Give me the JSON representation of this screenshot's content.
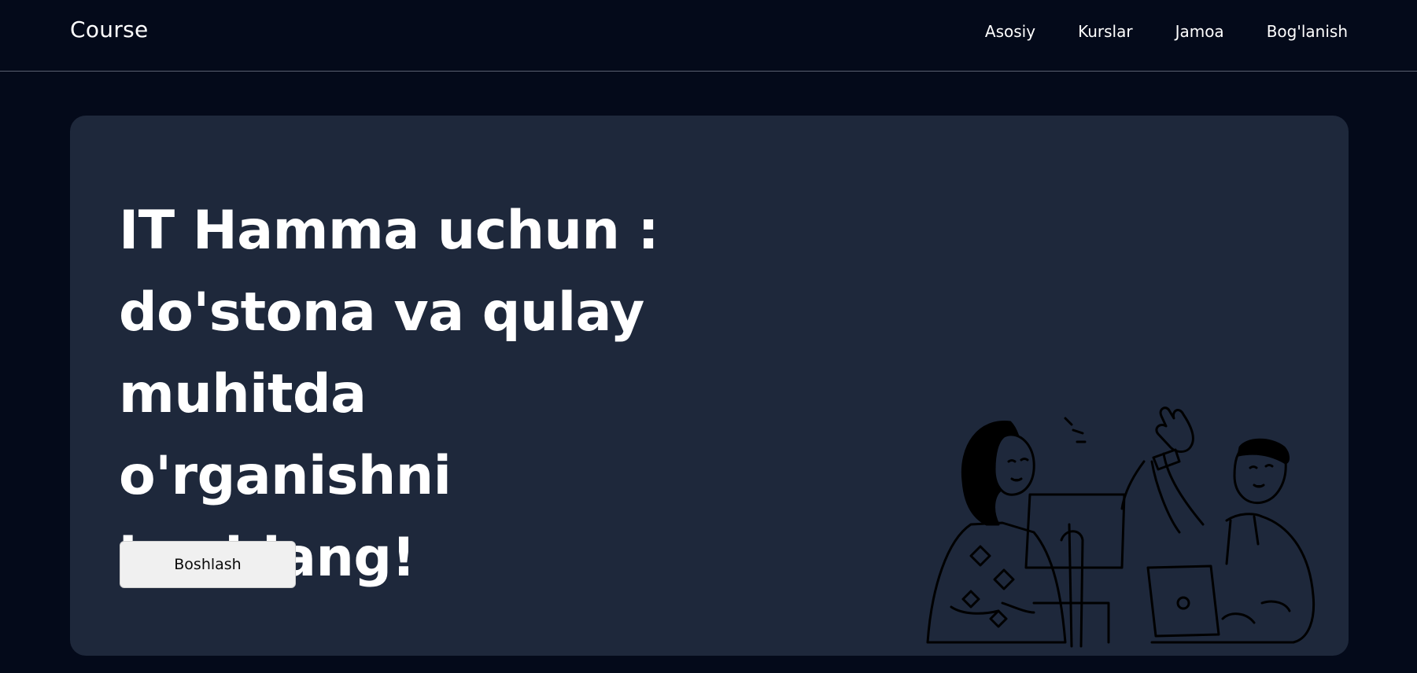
{
  "header": {
    "logo": "Course",
    "nav": [
      "Asosiy",
      "Kurslar",
      "Jamoa",
      "Bog'lanish"
    ]
  },
  "hero": {
    "headline_lines": [
      "IT Hamma uchun :",
      "do'stona va qulay",
      "muhitda o'rganishni",
      "boshlang!"
    ],
    "cta_label": "Boshlash"
  },
  "colors": {
    "page_bg": "#040a1a",
    "card_bg": "#1e283b",
    "text": "#ffffff",
    "button_bg": "#f0f0f0"
  }
}
